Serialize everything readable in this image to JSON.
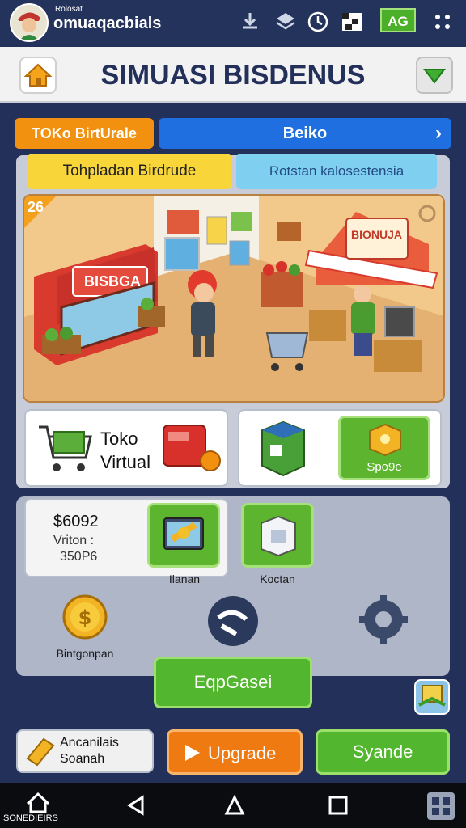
{
  "status_bar": {
    "app_small_label": "Rolosat",
    "app_name": "omuaqacbials",
    "badge": "AG",
    "icons": [
      "download-icon",
      "stack-icon",
      "clock-icon",
      "flag-icon",
      "more-icon"
    ]
  },
  "title_bar": {
    "title": "SIMUASI BISDENUS"
  },
  "tabs": {
    "left": "TOKo BirtUrale",
    "right": "Beiko"
  },
  "subtabs": {
    "left": "Tohpladan Birdrude",
    "right": "Rotstan kalosestensia"
  },
  "scene": {
    "corner_badge": "26",
    "left_store_sign": "BISBGA",
    "right_store_sign": "BIONUJA"
  },
  "cards": {
    "virtual_store": {
      "line1": "Toko",
      "line2": "Virtual"
    },
    "spore_label": "Spo9e"
  },
  "stats": {
    "money": "$6092",
    "visitors_label": "Vriton :",
    "visitors_value": "350P6"
  },
  "tiles": {
    "laptop_label": "Ilanan",
    "box_label": "Koctan",
    "coin_label": "Bintgonpan"
  },
  "buttons": {
    "main": "EqpGasei",
    "upgrade": "Upgrade",
    "syande": "Syande"
  },
  "bottom_card": {
    "line1": "Ancanilais",
    "line2": "Soanah"
  },
  "navbar": {
    "label": "SONEDIEIRS"
  },
  "colors": {
    "background": "#22305a",
    "orange": "#f29010",
    "blue": "#1f6fe0",
    "green": "#4caf2a"
  }
}
